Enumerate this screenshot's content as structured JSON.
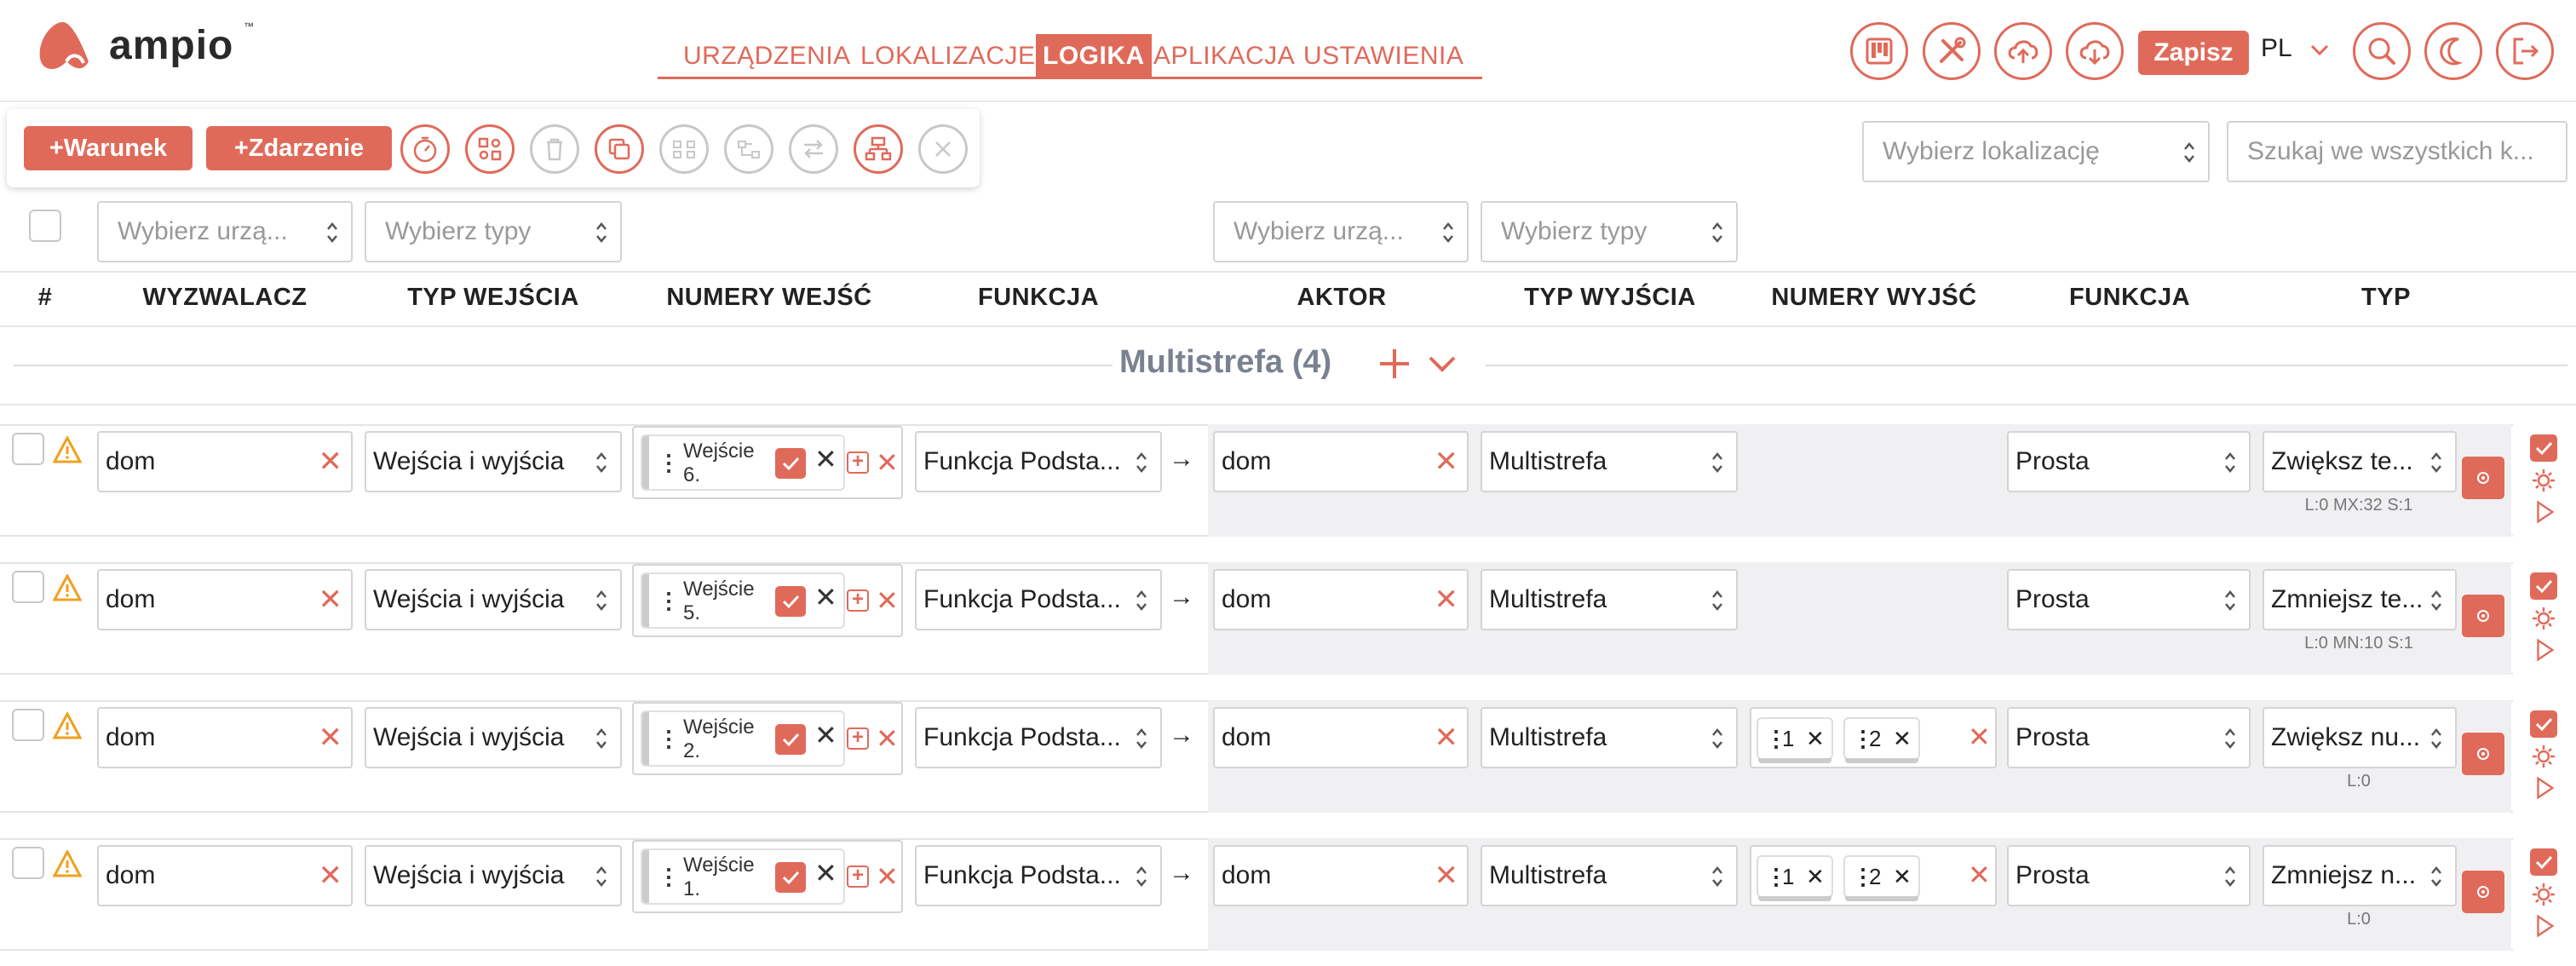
{
  "brand": {
    "logo_text": "ampio"
  },
  "nav": {
    "tabs": [
      {
        "label": "URZĄDZENIA"
      },
      {
        "label": "LOKALIZACJE"
      },
      {
        "label": "LOGIKA"
      },
      {
        "label": "APLIKACJA"
      },
      {
        "label": "USTAWIENIA"
      }
    ]
  },
  "header": {
    "save_label": "Zapisz",
    "lang": "PL"
  },
  "toolbar": {
    "add_condition": "+Warunek",
    "add_event": "+Zdarzenie"
  },
  "filters": {
    "location_placeholder": "Wybierz lokalizację",
    "search_placeholder": "Szukaj we wszystkich k...",
    "left_device": "Wybierz urzą...",
    "left_types": "Wybierz typy",
    "right_device": "Wybierz urzą...",
    "right_types": "Wybierz typy"
  },
  "columns": [
    "#",
    "WYZWALACZ",
    "TYP WEJŚCIA",
    "NUMERY WEJŚĆ",
    "FUNKCJA",
    "AKTOR",
    "TYP WYJŚCIA",
    "NUMERY WYJŚĆ",
    "FUNKCJA",
    "TYP"
  ],
  "group": {
    "title": "Multistrefa (4)"
  },
  "rows": [
    {
      "trigger": "dom",
      "input_type": "Wejścia i wyjścia",
      "input_entry": "Wejście 6.",
      "function": "Funkcja Podsta...",
      "actor": "dom",
      "output_type": "Multistrefa",
      "outputs": [],
      "out_function": "Prosta",
      "type": "Zwiększ te...",
      "sub": "L:0 MX:32 S:1"
    },
    {
      "trigger": "dom",
      "input_type": "Wejścia i wyjścia",
      "input_entry": "Wejście 5.",
      "function": "Funkcja Podsta...",
      "actor": "dom",
      "output_type": "Multistrefa",
      "outputs": [],
      "out_function": "Prosta",
      "type": "Zmniejsz te...",
      "sub": "L:0 MN:10 S:1"
    },
    {
      "trigger": "dom",
      "input_type": "Wejścia i wyjścia",
      "input_entry": "Wejście 2.",
      "function": "Funkcja Podsta...",
      "actor": "dom",
      "output_type": "Multistrefa",
      "outputs": [
        "1",
        "2"
      ],
      "out_function": "Prosta",
      "type": "Zwiększ nu...",
      "sub": "L:0"
    },
    {
      "trigger": "dom",
      "input_type": "Wejścia i wyjścia",
      "input_entry": "Wejście 1.",
      "function": "Funkcja Podsta...",
      "actor": "dom",
      "output_type": "Multistrefa",
      "outputs": [
        "1",
        "2"
      ],
      "out_function": "Prosta",
      "type": "Zmniejsz n...",
      "sub": "L:0"
    }
  ],
  "colors": {
    "accent": "#e06a5a",
    "border": "#d4d4d4",
    "muted": "#999999",
    "warning": "#f0a020"
  }
}
